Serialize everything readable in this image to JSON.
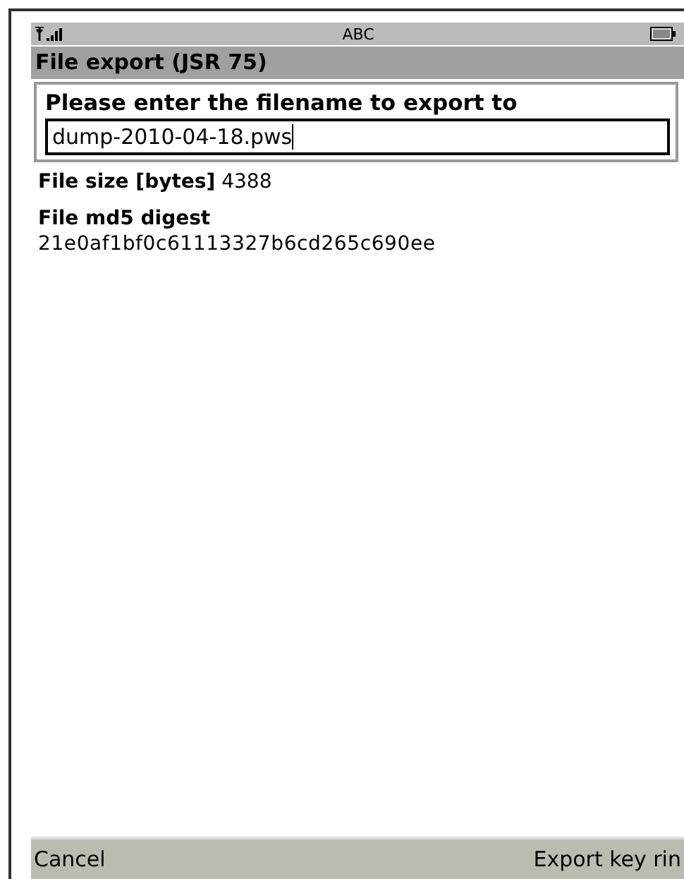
{
  "status_bar": {
    "input_mode": "ABC"
  },
  "title": "File export (JSR 75)",
  "filename_field": {
    "label": "Please enter the filename to export to",
    "value": "dump-2010-04-18.pws"
  },
  "file_size": {
    "label": "File size [bytes]",
    "value": "4388"
  },
  "digest": {
    "label": "File md5 digest",
    "value": "21e0af1bf0c61113327b6cd265c690ee"
  },
  "softkeys": {
    "left": "Cancel",
    "right": "Export key rin"
  }
}
